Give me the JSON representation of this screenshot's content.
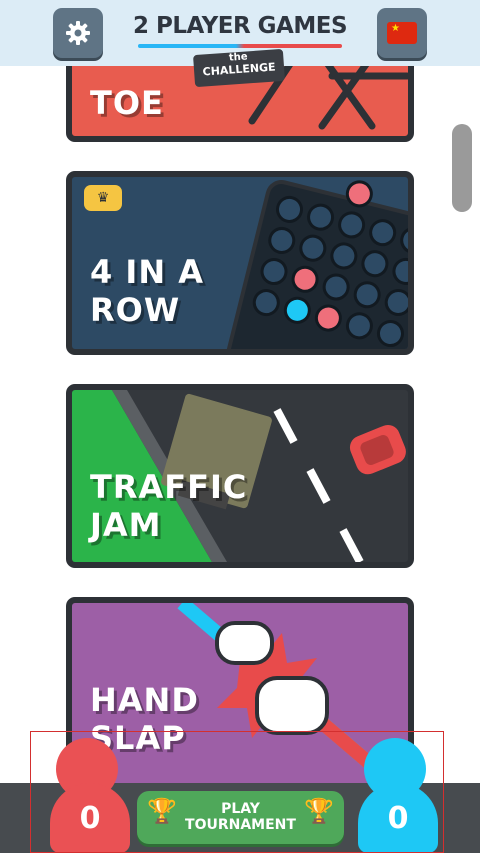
{
  "header": {
    "logo_text": "2 PLAYER GAMES",
    "tag_the": "the",
    "tag_challenge": "CHALLENGE",
    "settings_icon": "gear-icon",
    "language_icon": "china-flag-icon"
  },
  "games": [
    {
      "title": "TOE",
      "color": "#e85c4f"
    },
    {
      "title": "4 IN A\nROW",
      "color": "#2d4a64",
      "badge_icon": "crown-icon"
    },
    {
      "title": "TRAFFIC\nJAM",
      "color": "#34383d"
    },
    {
      "title": "HAND\nSLAP",
      "color": "#9d5fa6"
    }
  ],
  "players": {
    "red_score": "0",
    "blue_score": "0"
  },
  "tournament_button": {
    "label": "PLAY\nTOURNAMENT",
    "icon": "trophy-icon"
  }
}
